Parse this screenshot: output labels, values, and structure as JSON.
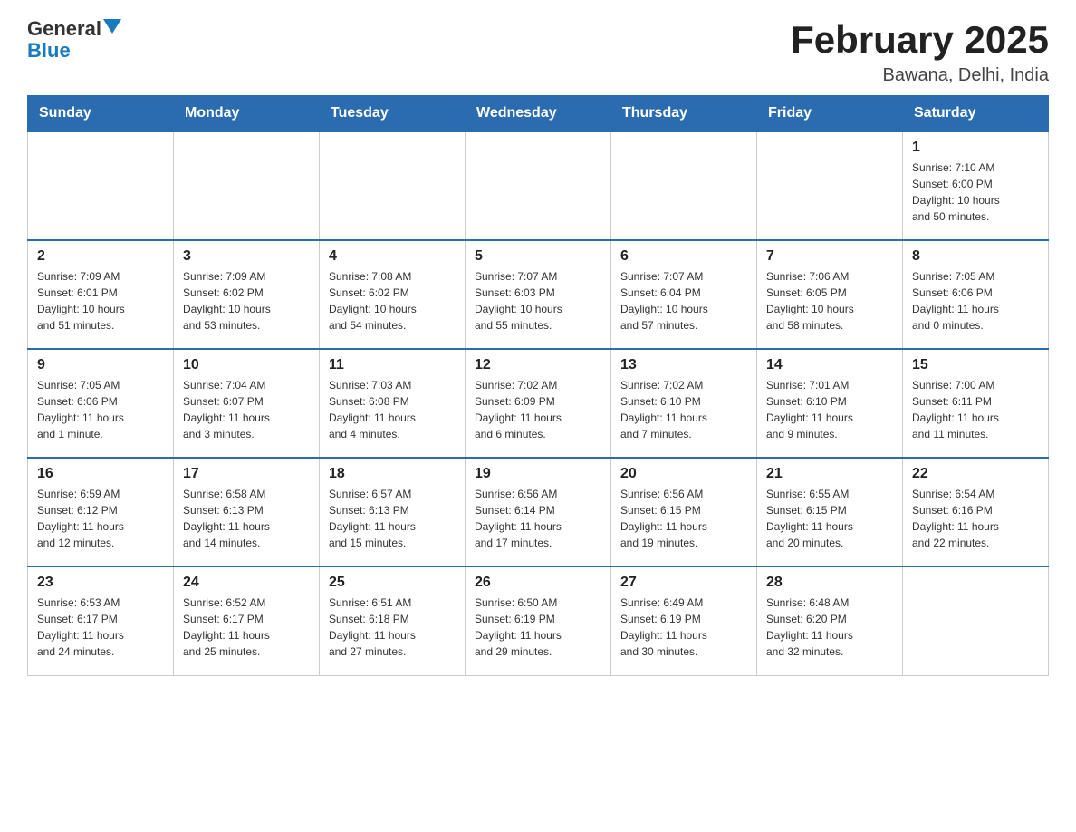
{
  "header": {
    "logo_general": "General",
    "logo_blue": "Blue",
    "month_title": "February 2025",
    "location": "Bawana, Delhi, India"
  },
  "days_of_week": [
    "Sunday",
    "Monday",
    "Tuesday",
    "Wednesday",
    "Thursday",
    "Friday",
    "Saturday"
  ],
  "weeks": [
    {
      "days": [
        {
          "number": "",
          "info": ""
        },
        {
          "number": "",
          "info": ""
        },
        {
          "number": "",
          "info": ""
        },
        {
          "number": "",
          "info": ""
        },
        {
          "number": "",
          "info": ""
        },
        {
          "number": "",
          "info": ""
        },
        {
          "number": "1",
          "info": "Sunrise: 7:10 AM\nSunset: 6:00 PM\nDaylight: 10 hours\nand 50 minutes."
        }
      ]
    },
    {
      "days": [
        {
          "number": "2",
          "info": "Sunrise: 7:09 AM\nSunset: 6:01 PM\nDaylight: 10 hours\nand 51 minutes."
        },
        {
          "number": "3",
          "info": "Sunrise: 7:09 AM\nSunset: 6:02 PM\nDaylight: 10 hours\nand 53 minutes."
        },
        {
          "number": "4",
          "info": "Sunrise: 7:08 AM\nSunset: 6:02 PM\nDaylight: 10 hours\nand 54 minutes."
        },
        {
          "number": "5",
          "info": "Sunrise: 7:07 AM\nSunset: 6:03 PM\nDaylight: 10 hours\nand 55 minutes."
        },
        {
          "number": "6",
          "info": "Sunrise: 7:07 AM\nSunset: 6:04 PM\nDaylight: 10 hours\nand 57 minutes."
        },
        {
          "number": "7",
          "info": "Sunrise: 7:06 AM\nSunset: 6:05 PM\nDaylight: 10 hours\nand 58 minutes."
        },
        {
          "number": "8",
          "info": "Sunrise: 7:05 AM\nSunset: 6:06 PM\nDaylight: 11 hours\nand 0 minutes."
        }
      ]
    },
    {
      "days": [
        {
          "number": "9",
          "info": "Sunrise: 7:05 AM\nSunset: 6:06 PM\nDaylight: 11 hours\nand 1 minute."
        },
        {
          "number": "10",
          "info": "Sunrise: 7:04 AM\nSunset: 6:07 PM\nDaylight: 11 hours\nand 3 minutes."
        },
        {
          "number": "11",
          "info": "Sunrise: 7:03 AM\nSunset: 6:08 PM\nDaylight: 11 hours\nand 4 minutes."
        },
        {
          "number": "12",
          "info": "Sunrise: 7:02 AM\nSunset: 6:09 PM\nDaylight: 11 hours\nand 6 minutes."
        },
        {
          "number": "13",
          "info": "Sunrise: 7:02 AM\nSunset: 6:10 PM\nDaylight: 11 hours\nand 7 minutes."
        },
        {
          "number": "14",
          "info": "Sunrise: 7:01 AM\nSunset: 6:10 PM\nDaylight: 11 hours\nand 9 minutes."
        },
        {
          "number": "15",
          "info": "Sunrise: 7:00 AM\nSunset: 6:11 PM\nDaylight: 11 hours\nand 11 minutes."
        }
      ]
    },
    {
      "days": [
        {
          "number": "16",
          "info": "Sunrise: 6:59 AM\nSunset: 6:12 PM\nDaylight: 11 hours\nand 12 minutes."
        },
        {
          "number": "17",
          "info": "Sunrise: 6:58 AM\nSunset: 6:13 PM\nDaylight: 11 hours\nand 14 minutes."
        },
        {
          "number": "18",
          "info": "Sunrise: 6:57 AM\nSunset: 6:13 PM\nDaylight: 11 hours\nand 15 minutes."
        },
        {
          "number": "19",
          "info": "Sunrise: 6:56 AM\nSunset: 6:14 PM\nDaylight: 11 hours\nand 17 minutes."
        },
        {
          "number": "20",
          "info": "Sunrise: 6:56 AM\nSunset: 6:15 PM\nDaylight: 11 hours\nand 19 minutes."
        },
        {
          "number": "21",
          "info": "Sunrise: 6:55 AM\nSunset: 6:15 PM\nDaylight: 11 hours\nand 20 minutes."
        },
        {
          "number": "22",
          "info": "Sunrise: 6:54 AM\nSunset: 6:16 PM\nDaylight: 11 hours\nand 22 minutes."
        }
      ]
    },
    {
      "days": [
        {
          "number": "23",
          "info": "Sunrise: 6:53 AM\nSunset: 6:17 PM\nDaylight: 11 hours\nand 24 minutes."
        },
        {
          "number": "24",
          "info": "Sunrise: 6:52 AM\nSunset: 6:17 PM\nDaylight: 11 hours\nand 25 minutes."
        },
        {
          "number": "25",
          "info": "Sunrise: 6:51 AM\nSunset: 6:18 PM\nDaylight: 11 hours\nand 27 minutes."
        },
        {
          "number": "26",
          "info": "Sunrise: 6:50 AM\nSunset: 6:19 PM\nDaylight: 11 hours\nand 29 minutes."
        },
        {
          "number": "27",
          "info": "Sunrise: 6:49 AM\nSunset: 6:19 PM\nDaylight: 11 hours\nand 30 minutes."
        },
        {
          "number": "28",
          "info": "Sunrise: 6:48 AM\nSunset: 6:20 PM\nDaylight: 11 hours\nand 32 minutes."
        },
        {
          "number": "",
          "info": ""
        }
      ]
    }
  ]
}
